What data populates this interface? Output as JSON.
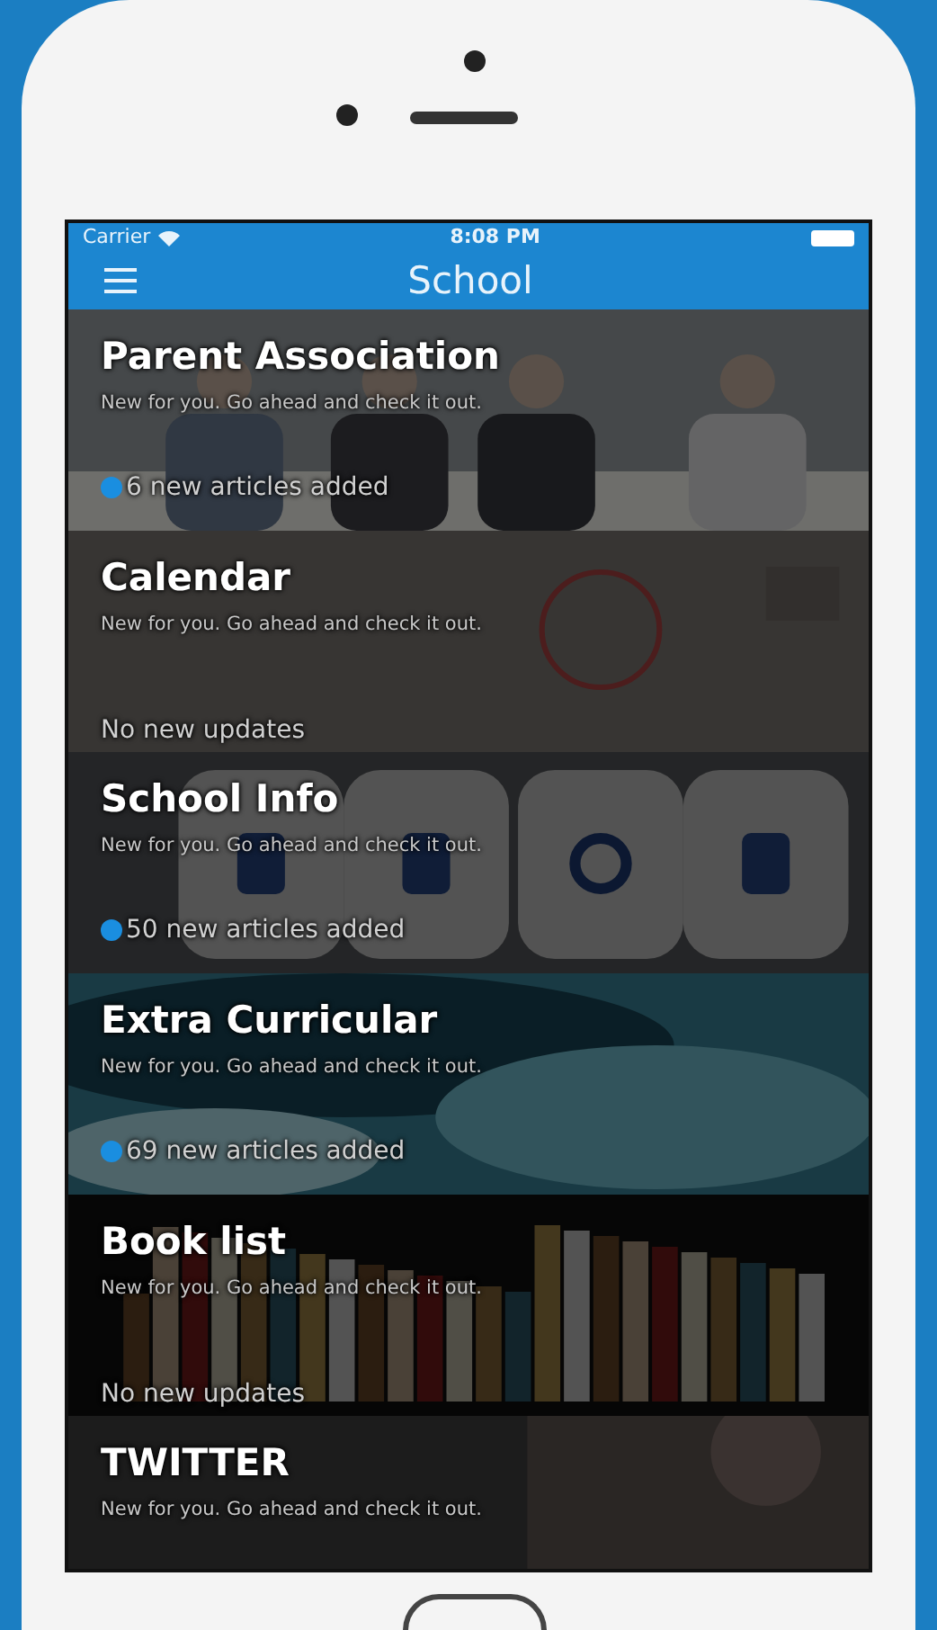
{
  "status_bar": {
    "carrier": "Carrier",
    "time": "8:08 PM"
  },
  "nav_bar": {
    "title": "School"
  },
  "sections": [
    {
      "title": "Parent Association",
      "subtitle": "New for you. Go ahead and check it out.",
      "status": "6 new articles added",
      "has_new": true
    },
    {
      "title": "Calendar",
      "subtitle": "New for you. Go ahead and check it out.",
      "status": "No new updates",
      "has_new": false
    },
    {
      "title": "School Info",
      "subtitle": "New for you. Go ahead and check it out.",
      "status": "50 new articles added",
      "has_new": true
    },
    {
      "title": "Extra Curricular",
      "subtitle": "New for you. Go ahead and check it out.",
      "status": "69 new articles added",
      "has_new": true
    },
    {
      "title": "Book list",
      "subtitle": "New for you. Go ahead and check it out.",
      "status": "No new updates",
      "has_new": false
    },
    {
      "title": "TWITTER",
      "subtitle": "New for you. Go ahead and check it out."
    }
  ]
}
